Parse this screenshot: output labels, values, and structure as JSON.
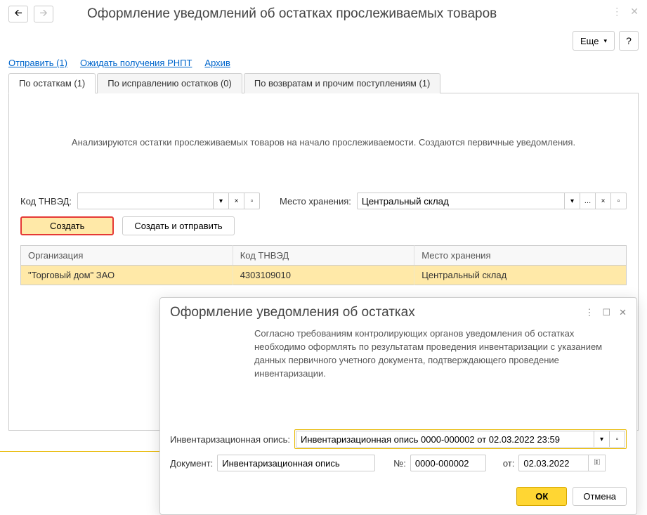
{
  "header": {
    "title": "Оформление уведомлений об остатках прослеживаемых товаров",
    "more_btn": "Еще",
    "help_btn": "?"
  },
  "links": {
    "send": "Отправить (1)",
    "await": "Ожидать получения РНПТ",
    "archive": "Архив"
  },
  "tabs": [
    {
      "label": "По остаткам (1)"
    },
    {
      "label": "По исправлению остатков (0)"
    },
    {
      "label": "По возвратам и прочим поступлениям (1)"
    }
  ],
  "pane": {
    "info": "Анализируются остатки прослеживаемых товаров на начало прослеживаемости. Создаются первичные уведомления.",
    "tnved_label": "Код ТНВЭД:",
    "tnved_value": "",
    "storage_label": "Место хранения:",
    "storage_value": "Центральный склад",
    "create_btn": "Создать",
    "create_send_btn": "Создать и отправить"
  },
  "table": {
    "columns": [
      "Организация",
      "Код ТНВЭД",
      "Место хранения"
    ],
    "rows": [
      {
        "org": "\"Торговый дом\" ЗАО",
        "tnved": "4303109010",
        "storage": "Центральный склад"
      }
    ]
  },
  "dialog": {
    "title": "Оформление уведомления об остатках",
    "text": "Согласно требованиям контролирующих органов уведомления об остатках необходимо оформлять по результатам проведения инвентаризации с указанием данных первичного учетного документа, подтверждающего проведение инвентаризации.",
    "inv_label": "Инвентаризационная опись:",
    "inv_value": "Инвентаризационная опись 0000-000002 от 02.03.2022 23:59",
    "doc_label": "Документ:",
    "doc_value": "Инвентаризационная опись",
    "num_label": "№:",
    "num_value": "0000-000002",
    "date_label": "от:",
    "date_value": "02.03.2022",
    "ok": "ОК",
    "cancel": "Отмена"
  }
}
